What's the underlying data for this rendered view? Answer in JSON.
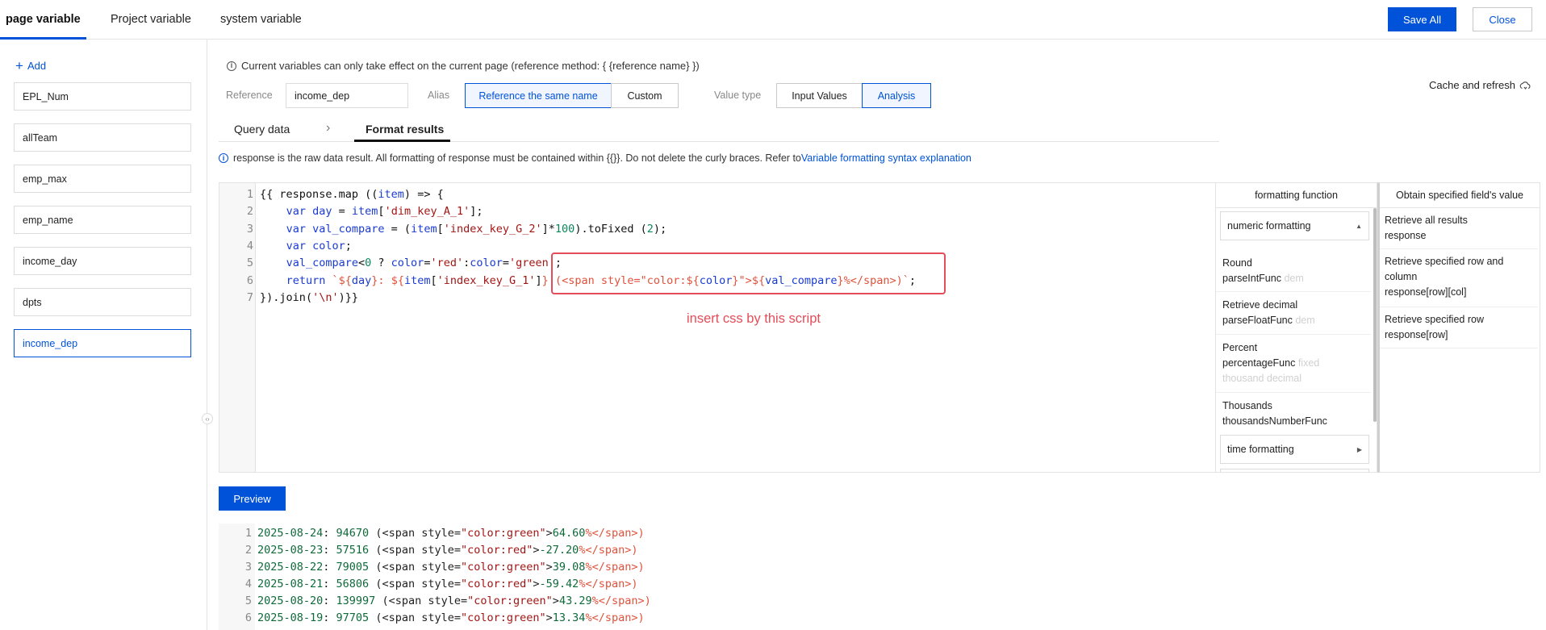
{
  "top_tabs": [
    "page variable",
    "Project variable",
    "system variable"
  ],
  "header_buttons": {
    "save_all": "Save All",
    "close": "Close"
  },
  "sidebar": {
    "add_label": "Add",
    "items": [
      "EPL_Num",
      "allTeam",
      "emp_max",
      "emp_name",
      "income_day",
      "dpts",
      "income_dep"
    ],
    "selected": "income_dep"
  },
  "notice": "Current variables can only take effect on the current page (reference method: { {reference name} })",
  "cache_refresh": "Cache and refresh",
  "form": {
    "reference_label": "Reference",
    "reference_value": "income_dep",
    "alias_label": "Alias",
    "alias_options": [
      "Reference the same name",
      "Custom"
    ],
    "alias_selected": "Reference the same name",
    "value_type_label": "Value type",
    "value_type_options": [
      "Input Values",
      "Analysis"
    ],
    "value_type_selected": "Analysis"
  },
  "sub_tabs": [
    "Query data",
    "Format results"
  ],
  "sub_tab_active": "Format results",
  "response_note": {
    "text": "response is the raw data result. All formatting of response must be contained within {{}}. Do not delete the curly braces. Refer to",
    "link": "Variable formatting syntax explanation"
  },
  "code_lines": [
    "{{ response.map ((item) => {",
    "    var day = item['dim_key_A_1'];",
    "    var val_compare = (item['index_key_G_2']*100).toFixed (2);",
    "    var color;",
    "    val_compare<0 ? color='red':color='green';",
    "    return `${day}: ${item['index_key_G_1']} (<span style=\"color:${color}\">${val_compare}%</span>)`;",
    "}).join('\\n')}}"
  ],
  "callout_text": "insert css by this script",
  "formatting_panel": {
    "header": "formatting function",
    "group1": "numeric formatting",
    "items": [
      {
        "title": "Round",
        "func": "parseIntFunc",
        "hint": "dem"
      },
      {
        "title": "Retrieve decimal",
        "func": "parseFloatFunc",
        "hint": "dem"
      },
      {
        "title": "Percent",
        "func": "percentageFunc",
        "hint": "fixed",
        "hint2": "thousand decimal"
      },
      {
        "title": "Thousands",
        "func": "thousandsNumberFunc",
        "hint": ""
      }
    ],
    "group2": "time formatting"
  },
  "field_panel": {
    "header": "Obtain specified field's value",
    "items": [
      {
        "title": "Retrieve all results",
        "code": "response"
      },
      {
        "title": "Retrieve specified row and column",
        "code": "response[row][col]"
      },
      {
        "title": "Retrieve specified row",
        "code": "response[row]"
      }
    ]
  },
  "preview_label": "Preview",
  "output_lines": [
    {
      "date": "2025-08-24",
      "value": "94670",
      "color": "green",
      "pct": "64.60"
    },
    {
      "date": "2025-08-23",
      "value": "57516",
      "color": "red",
      "pct": "-27.20"
    },
    {
      "date": "2025-08-22",
      "value": "79005",
      "color": "green",
      "pct": "39.08"
    },
    {
      "date": "2025-08-21",
      "value": "56806",
      "color": "red",
      "pct": "-59.42"
    },
    {
      "date": "2025-08-20",
      "value": "139997",
      "color": "green",
      "pct": "43.29"
    },
    {
      "date": "2025-08-19",
      "value": "97705",
      "color": "green",
      "pct": "13.34"
    }
  ],
  "colors": {
    "accent": "#0052d9",
    "callout": "#e34d59"
  }
}
